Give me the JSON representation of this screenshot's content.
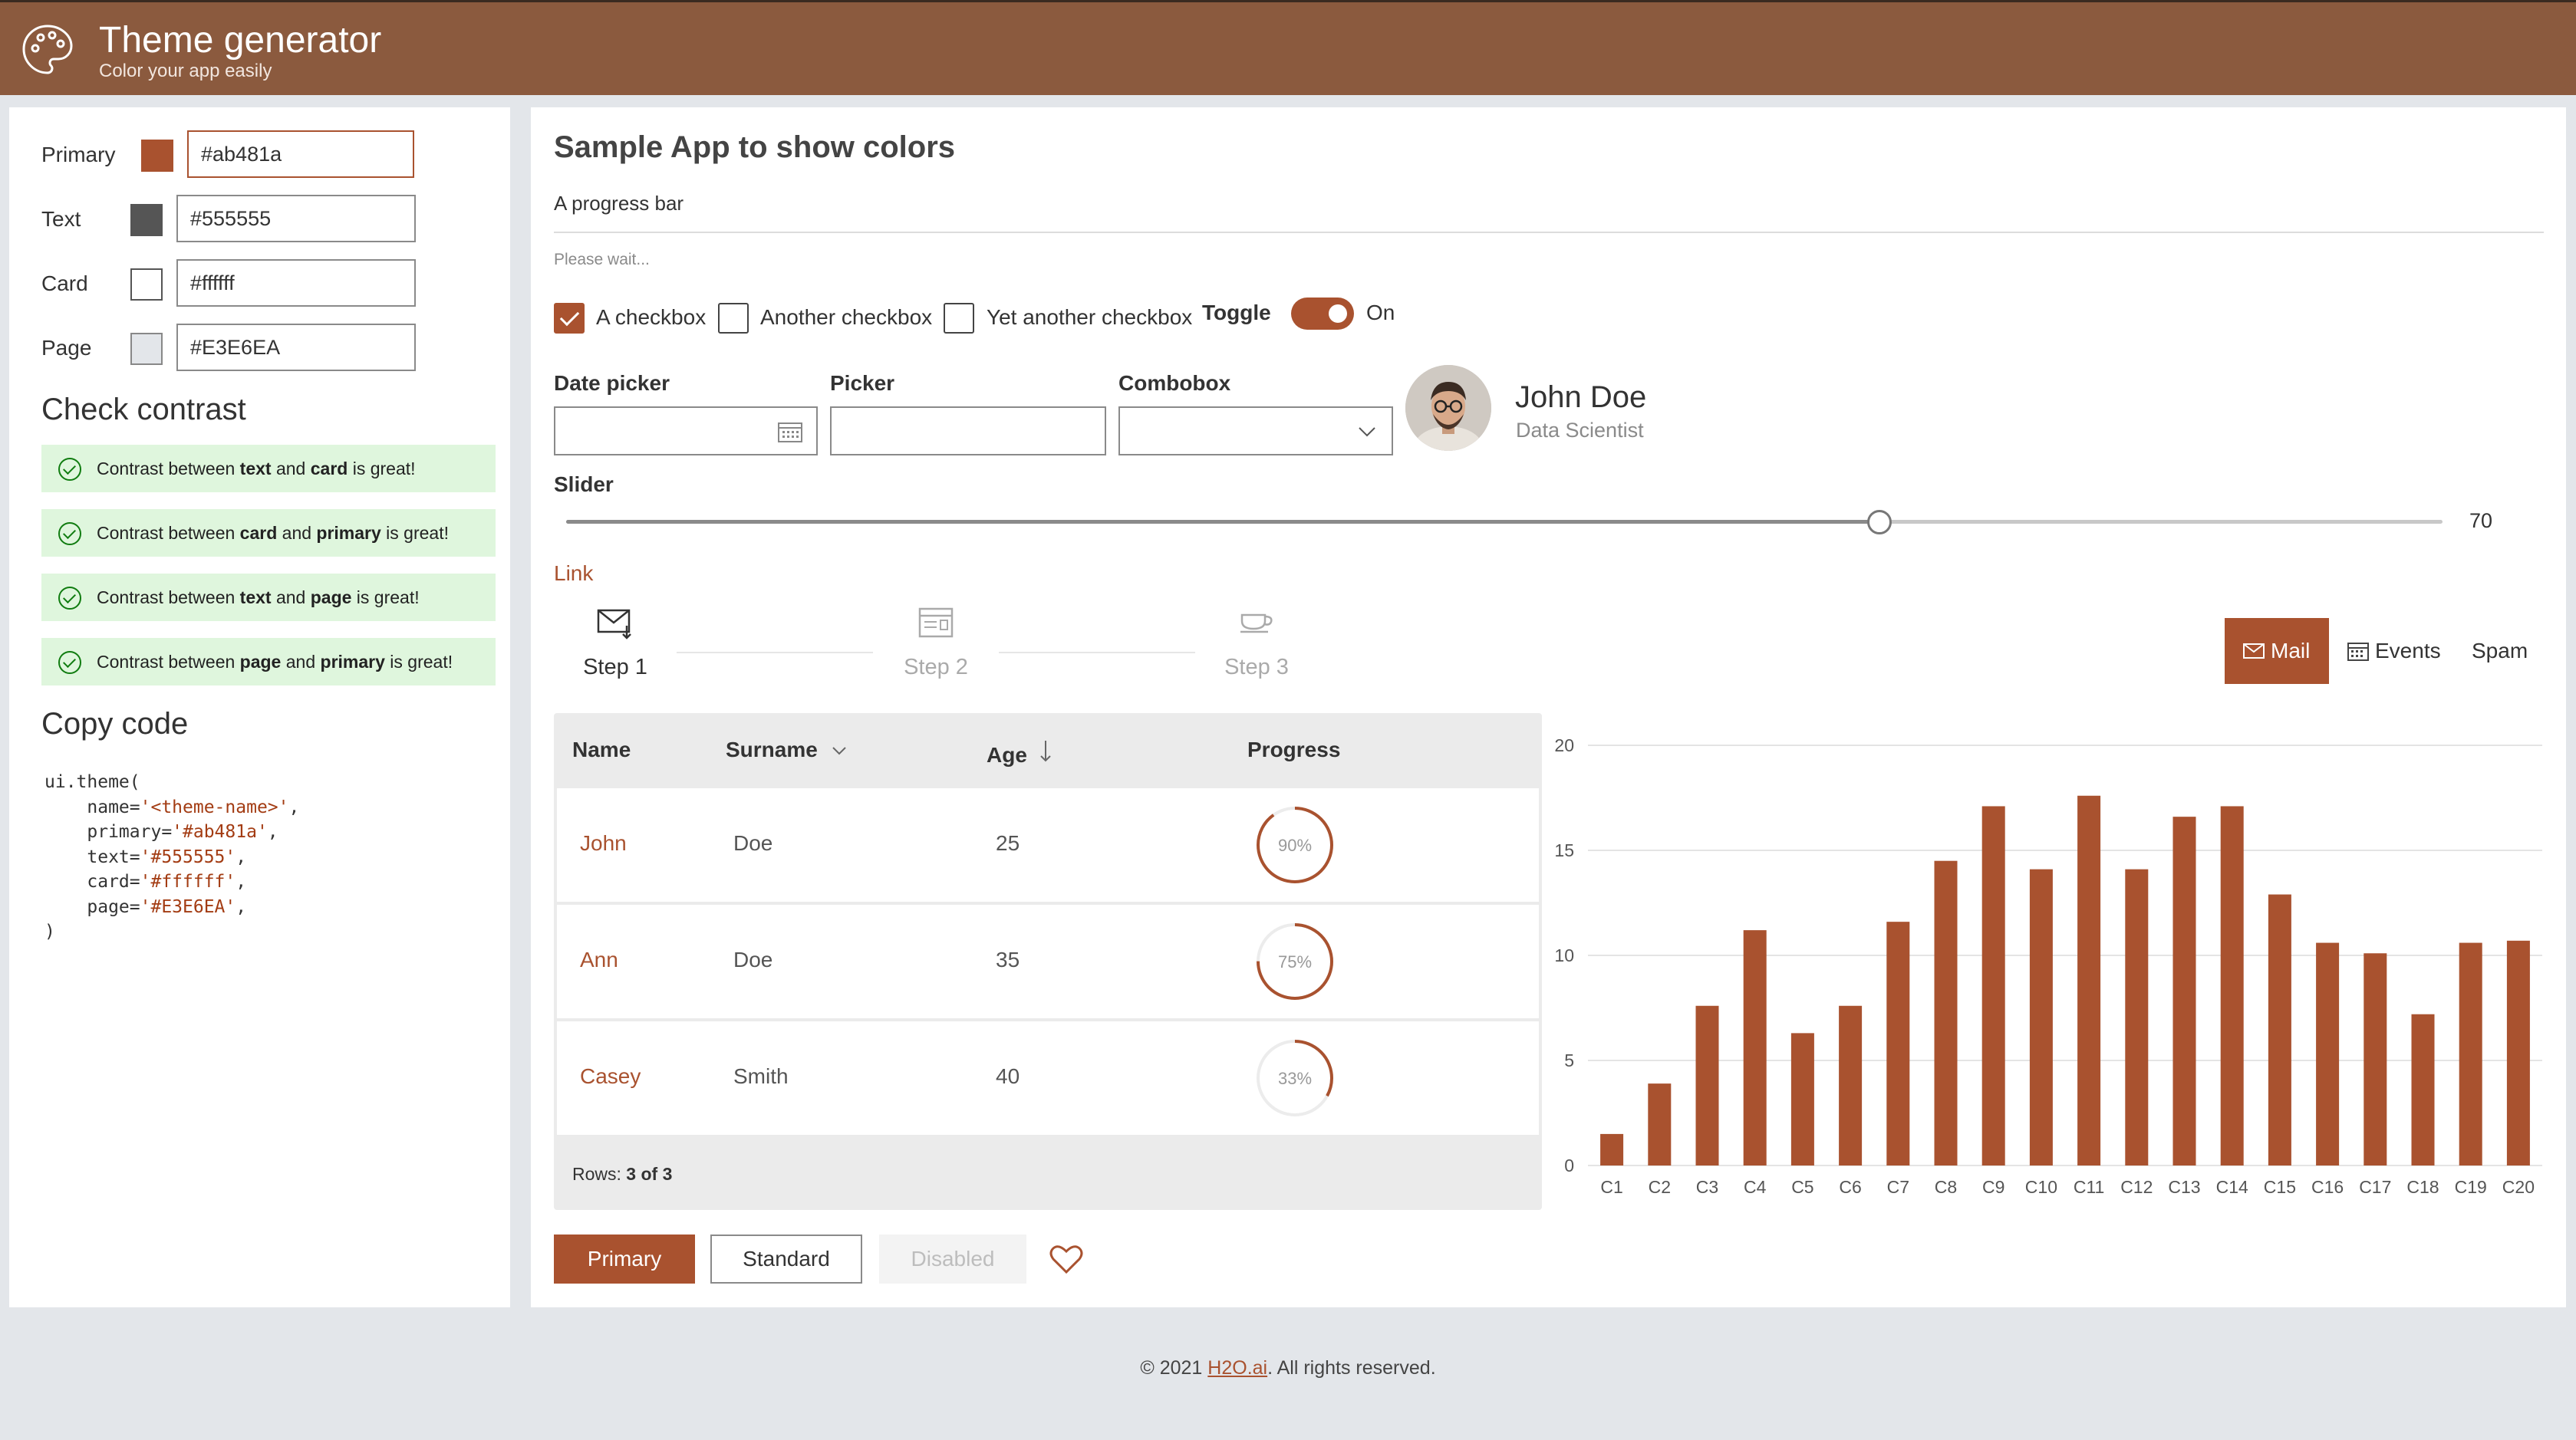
{
  "header": {
    "title": "Theme generator",
    "subtitle": "Color your app easily",
    "logo_icon": "palette-icon"
  },
  "theme": {
    "rows": [
      {
        "label": "Primary",
        "value": "#ab481a",
        "swatch": "#a9522f"
      },
      {
        "label": "Text",
        "value": "#555555",
        "swatch": "#555555"
      },
      {
        "label": "Card",
        "value": "#ffffff",
        "swatch": "#ffffff"
      },
      {
        "label": "Page",
        "value": "#E3E6EA",
        "swatch": "#e3e6ea"
      }
    ]
  },
  "contrast": {
    "title": "Check contrast",
    "items": [
      {
        "pre": "Contrast between ",
        "a": "text",
        "mid": " and ",
        "b": "card",
        "post": " is great!"
      },
      {
        "pre": "Contrast between ",
        "a": "card",
        "mid": " and ",
        "b": "primary",
        "post": " is great!"
      },
      {
        "pre": "Contrast between ",
        "a": "text",
        "mid": " and ",
        "b": "page",
        "post": " is great!"
      },
      {
        "pre": "Contrast between ",
        "a": "page",
        "mid": " and ",
        "b": "primary",
        "post": " is great!"
      }
    ]
  },
  "code": {
    "title": "Copy code",
    "l1": "ui.theme(",
    "l2a": "    name=",
    "l2b": "'<theme-name>'",
    "l2c": ",",
    "l3a": "    primary=",
    "l3b": "'#ab481a'",
    "l3c": ",",
    "l4a": "    text=",
    "l4b": "'#555555'",
    "l4c": ",",
    "l5a": "    card=",
    "l5b": "'#ffffff'",
    "l5c": ",",
    "l6a": "    page=",
    "l6b": "'#E3E6EA'",
    "l6c": ",",
    "l7": ")"
  },
  "sample": {
    "title": "Sample App to show colors",
    "progress_label": "A progress bar",
    "progress_caption": "Please wait..."
  },
  "checkboxes": [
    {
      "label": "A checkbox",
      "checked": true
    },
    {
      "label": "Another checkbox",
      "checked": false
    },
    {
      "label": "Yet another checkbox",
      "checked": false
    }
  ],
  "toggle": {
    "label": "Toggle",
    "state": "On"
  },
  "fields": {
    "date_picker": "Date picker",
    "picker": "Picker",
    "combobox": "Combobox"
  },
  "persona": {
    "name": "John Doe",
    "role": "Data Scientist"
  },
  "slider": {
    "label": "Slider",
    "value": "70",
    "min": 0,
    "max": 100
  },
  "link": "Link",
  "stepper": [
    {
      "label": "Step 1",
      "icon": "mail-icon",
      "active": true
    },
    {
      "label": "Step 2",
      "icon": "calendar-icon",
      "active": false
    },
    {
      "label": "Step 3",
      "icon": "coffee-icon",
      "active": false
    }
  ],
  "tabs": [
    {
      "label": "Mail",
      "icon": "mail-icon",
      "selected": true
    },
    {
      "label": "Events",
      "icon": "calendar-icon",
      "selected": false
    },
    {
      "label": "Spam",
      "selected": false
    }
  ],
  "table": {
    "columns": [
      "Name",
      "Surname",
      "Age",
      "Progress"
    ],
    "rows": [
      {
        "name": "John",
        "surname": "Doe",
        "age": "25",
        "progress": "90%",
        "fraction": 0.9
      },
      {
        "name": "Ann",
        "surname": "Doe",
        "age": "35",
        "progress": "75%",
        "fraction": 0.75
      },
      {
        "name": "Casey",
        "surname": "Smith",
        "age": "40",
        "progress": "33%",
        "fraction": 0.33
      }
    ],
    "rows_label": "Rows:",
    "rows_count": "3 of 3"
  },
  "buttons": {
    "primary": "Primary",
    "standard": "Standard",
    "disabled": "Disabled",
    "heart_icon": "heart-icon"
  },
  "footer": {
    "pre": "© 2021 ",
    "link": "H2O.ai",
    "post": ". All rights reserved."
  },
  "colors": {
    "primary": "#a9522f",
    "text": "#555555",
    "card": "#ffffff",
    "page": "#e3e6ea"
  },
  "chart_data": {
    "type": "bar",
    "categories": [
      "C1",
      "C2",
      "C3",
      "C4",
      "C5",
      "C6",
      "C7",
      "C8",
      "C9",
      "C10",
      "C11",
      "C12",
      "C13",
      "C14",
      "C15",
      "C16",
      "C17",
      "C18",
      "C19",
      "C20"
    ],
    "values": [
      1.5,
      3.9,
      7.6,
      11.2,
      6.3,
      7.6,
      11.6,
      14.5,
      17.1,
      14.1,
      17.6,
      14.1,
      16.6,
      17.1,
      12.9,
      10.6,
      10.1,
      7.2,
      10.6,
      10.7
    ],
    "ylim": [
      0,
      20
    ],
    "yticks": [
      "0",
      "5",
      "10",
      "15",
      "20"
    ],
    "grid": true,
    "color": "#a9522f"
  }
}
